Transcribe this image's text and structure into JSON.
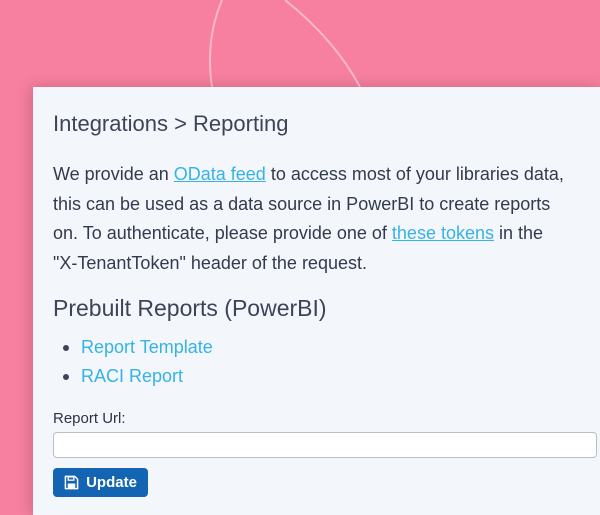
{
  "header": {
    "breadcrumb": "Integrations > Reporting"
  },
  "intro": {
    "line1_prefix": "We provide an ",
    "odata_link": "OData feed",
    "line1_suffix": " to access most of your libraries data,",
    "line2": "this can be used as a data source in PowerBI to create reports",
    "line3_prefix": "on. To authenticate, please provide one of ",
    "tokens_link": "these tokens",
    "line3_suffix": " in the",
    "line4": "\"X-TenantToken\" header of the request."
  },
  "prebuilt": {
    "title": "Prebuilt Reports (PowerBI)",
    "items": [
      {
        "label": "Report Template"
      },
      {
        "label": "RACI Report"
      }
    ]
  },
  "form": {
    "url_label": "Report Url:",
    "url_value": "",
    "url_placeholder": "",
    "update_label": "Update",
    "update_icon": "save-icon"
  },
  "colors": {
    "background": "#f77fa0",
    "card": "#f3f6fa",
    "link": "#35b3e6",
    "button": "#1464b4"
  }
}
